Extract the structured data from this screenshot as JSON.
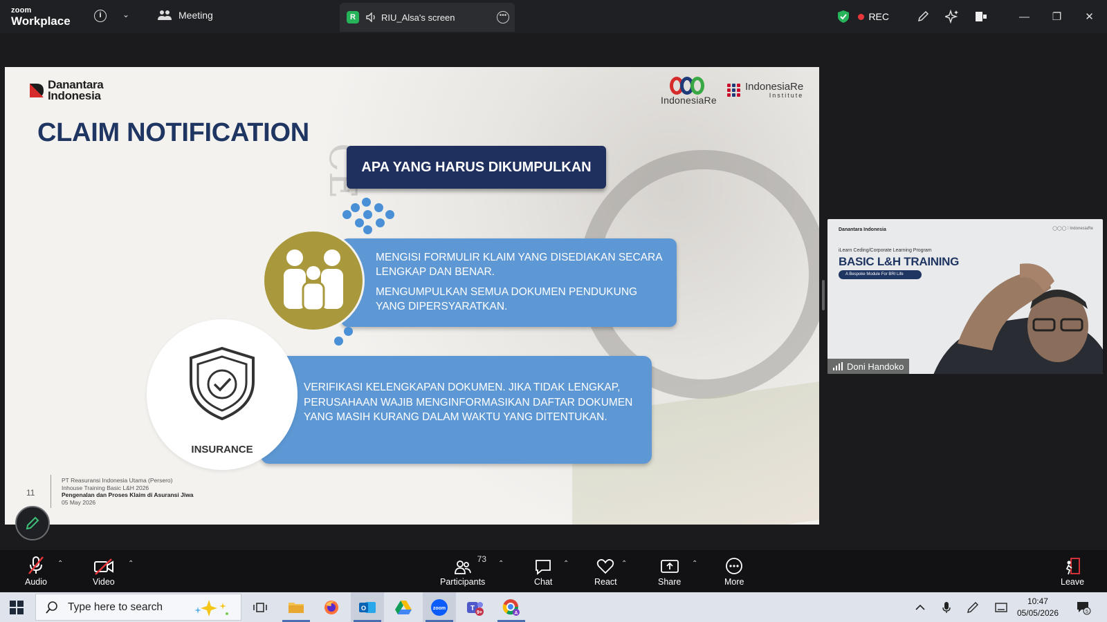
{
  "app": {
    "logo_line1": "zoom",
    "logo_line2": "Workplace",
    "meeting_label": "Meeting",
    "share_tab_badge": "R",
    "share_tab_label": "RIU_Alsa's screen",
    "rec_label": "REC"
  },
  "slide": {
    "org_logo_line1": "Danantara",
    "org_logo_line2": "Indonesia",
    "partner_logo": "IndonesiaRe",
    "institute_logo_line1": "IndonesiaRe",
    "institute_logo_line2": "Institute",
    "title": "CLAIM NOTIFICATION",
    "section_header": "APA YANG HARUS DIKUMPULKAN",
    "box1_line1": "MENGISI FORMULIR KLAIM YANG DISEDIAKAN SECARA LENGKAP DAN BENAR.",
    "box1_line2": "MENGUMPULKAN SEMUA DOKUMEN PENDUKUNG YANG DIPERSYARATKAN.",
    "box2_text": "VERIFIKASI KELENGKAPAN DOKUMEN. JIKA TIDAK LENGKAP, PERUSAHAAN WAJIB MENGINFORMASIKAN DAFTAR DOKUMEN YANG MASIH KURANG DALAM WAKTU YANG DITENTUKAN.",
    "insurance_label": "INSURANCE",
    "page_number": "11",
    "footer_line1": "PT Reasuransi Indonesia Utama (Persero)",
    "footer_line2": "Inhouse Training Basic L&H 2026",
    "footer_line3": "Pengenalan dan Proses Klaim di Asuransi Jiwa",
    "footer_line4": "05 May 2026"
  },
  "video": {
    "participant_name": "Doni Handoko",
    "bg_logo": "Danantara Indonesia",
    "bg_subtitle": "iLearn Ceding/Corporate Learning Program",
    "bg_title": "BASIC L&H TRAINING",
    "bg_pill": "A Bespoke Module For BRI Life"
  },
  "toolbar": {
    "audio": "Audio",
    "video": "Video",
    "participants": "Participants",
    "participants_count": "73",
    "chat": "Chat",
    "react": "React",
    "share": "Share",
    "more": "More",
    "leave": "Leave"
  },
  "taskbar": {
    "search_placeholder": "Type here to search",
    "time": "10:47",
    "date": "05/05/2026",
    "notification_count": "5"
  },
  "colors": {
    "zoom_dark": "#1f2024",
    "slide_title": "#1f3562",
    "box_blue": "#5d98d4",
    "header_navy": "#1f2f5e",
    "gold": "#a9993c",
    "rec_red": "#e8363b",
    "shield_green": "#26b35a"
  }
}
